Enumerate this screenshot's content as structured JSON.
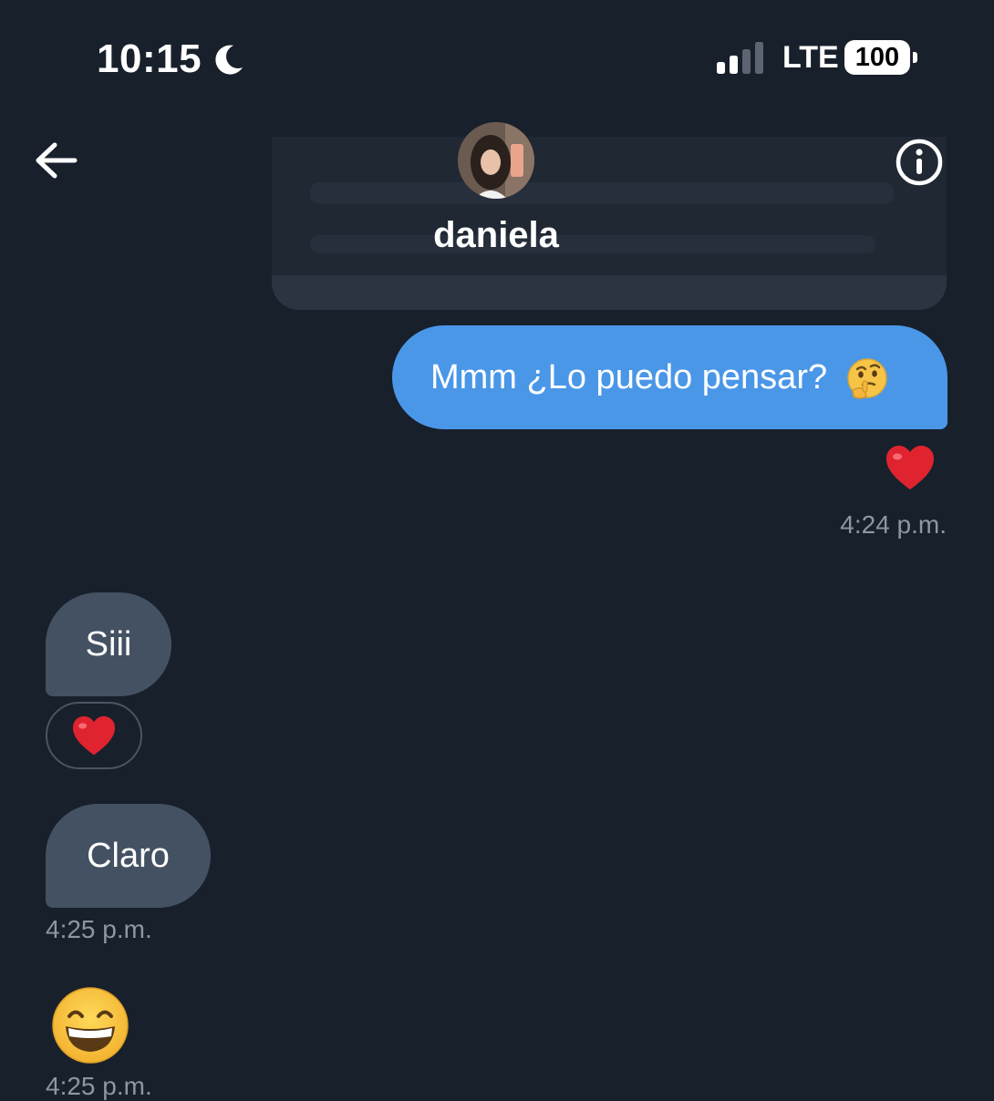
{
  "status_bar": {
    "time": "10:15",
    "network": "LTE",
    "battery": "100",
    "moon_icon": "moon-icon",
    "signal_icon": "signal-icon"
  },
  "header": {
    "contact_name": "daniela",
    "back_icon": "arrow-left-icon",
    "info_icon": "info-icon"
  },
  "messages": [
    {
      "direction": "outgoing",
      "text": "Mmm ¿Lo puedo pensar?",
      "emoji": "thinking-face",
      "reaction": "heart",
      "time": "4:24 p.m."
    },
    {
      "direction": "incoming",
      "text": "Siii",
      "reaction": "heart"
    },
    {
      "direction": "incoming",
      "text": "Claro",
      "time": "4:25 p.m."
    },
    {
      "direction": "incoming",
      "emoji": "grinning-face",
      "time": "4:25 p.m."
    }
  ],
  "colors": {
    "background": "#18202b",
    "outgoing_bubble": "#4a97e8",
    "incoming_bubble": "#435162",
    "timestamp": "#8d96a1"
  }
}
